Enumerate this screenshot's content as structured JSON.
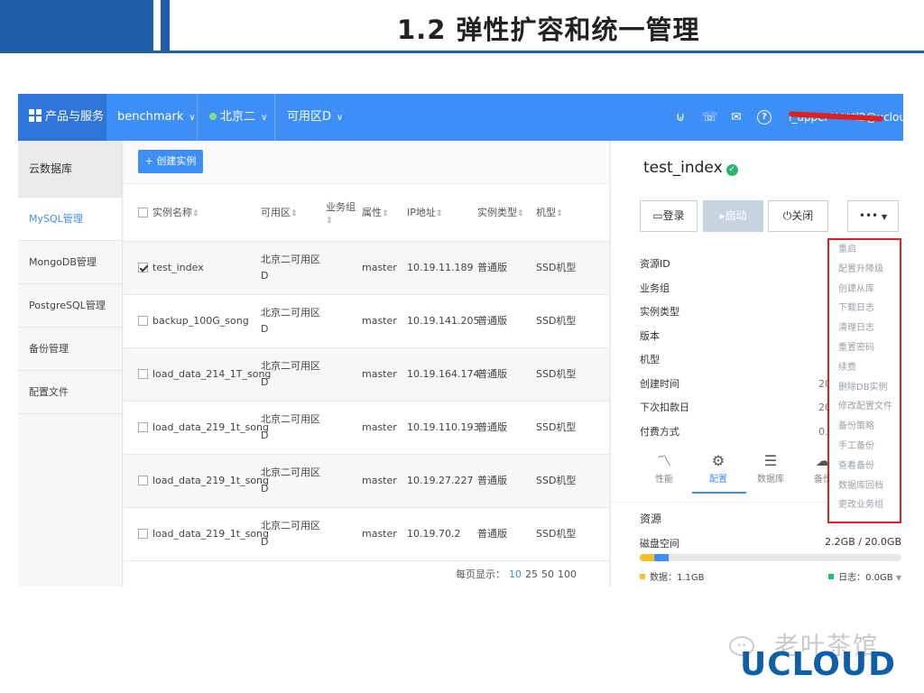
{
  "slide": {
    "title": "1.2 弹性扩容和统一管理"
  },
  "topbar": {
    "brand": "产品与服务",
    "project": "benchmark",
    "region": "北京二",
    "zone": "可用区D",
    "user": "l_upper*****l2@ucloud.cn"
  },
  "sidebar": {
    "header": "云数据库",
    "items": [
      {
        "label": "MySQL管理",
        "active": true
      },
      {
        "label": "MongoDB管理",
        "active": false
      },
      {
        "label": "PostgreSQL管理",
        "active": false
      },
      {
        "label": "备份管理",
        "active": false
      },
      {
        "label": "配置文件",
        "active": false
      }
    ]
  },
  "main": {
    "create_button": "+ 创建实例",
    "columns": [
      "实例名称",
      "可用区",
      "业务组",
      "属性",
      "IP地址",
      "实例类型",
      "机型"
    ],
    "rows": [
      {
        "checked": true,
        "name": "test_index",
        "zone": "北京二可用区D",
        "role": "master",
        "ip": "10.19.11.189",
        "type": "普通版",
        "machine": "SSD机型"
      },
      {
        "checked": false,
        "name": "backup_100G_song",
        "zone": "北京二可用区D",
        "role": "master",
        "ip": "10.19.141.205",
        "type": "普通版",
        "machine": "SSD机型"
      },
      {
        "checked": false,
        "name": "load_data_214_1T_song",
        "zone": "北京二可用区D",
        "role": "master",
        "ip": "10.19.164.174",
        "type": "普通版",
        "machine": "SSD机型"
      },
      {
        "checked": false,
        "name": "load_data_219_1t_song",
        "zone": "北京二可用区D",
        "role": "master",
        "ip": "10.19.110.193",
        "type": "普通版",
        "machine": "SSD机型"
      },
      {
        "checked": false,
        "name": "load_data_219_1t_song",
        "zone": "北京二可用区D",
        "role": "master",
        "ip": "10.19.27.227",
        "type": "普通版",
        "machine": "SSD机型"
      },
      {
        "checked": false,
        "name": "load_data_219_1t_song",
        "zone": "北京二可用区D",
        "role": "master",
        "ip": "10.19.70.2",
        "type": "普通版",
        "machine": "SSD机型"
      }
    ],
    "pager": {
      "label": "每页显示：",
      "sizes": [
        "10",
        "25",
        "50",
        "100"
      ],
      "active": "10"
    }
  },
  "detail": {
    "title": "test_index",
    "buttons": {
      "login": "登录",
      "start": "启动",
      "stop": "关闭",
      "more": "•••"
    },
    "props": [
      {
        "label": "资源ID",
        "value": ""
      },
      {
        "label": "业务组",
        "value": ""
      },
      {
        "label": "实例类型",
        "value": ""
      },
      {
        "label": "版本",
        "value": ""
      },
      {
        "label": "机型",
        "value": ""
      },
      {
        "label": "创建时间",
        "value": "20"
      },
      {
        "label": "下次扣款日",
        "value": "20"
      },
      {
        "label": "付费方式",
        "value": "0."
      }
    ],
    "tabs": [
      {
        "label": "性能",
        "icon": "line-chart-icon"
      },
      {
        "label": "配置",
        "icon": "gear-icon"
      },
      {
        "label": "数据库",
        "icon": "database-icon"
      },
      {
        "label": "备份",
        "icon": "cloud-backup-icon"
      }
    ],
    "active_tab": "配置",
    "resources": {
      "title": "资源",
      "disk_label": "磁盘空间",
      "disk_value": "2.2GB / 20.0GB",
      "data_fraction": 0.055,
      "log_fraction": 0.055,
      "data_legend": "数据：1.1GB",
      "log_legend": "日志：0.0GB"
    }
  },
  "menu": {
    "items": [
      "重启",
      "配置升降级",
      "创建从库",
      "下载日志",
      "清理日志",
      "重置密码",
      "续费",
      "删除DB实例",
      "修改配置文件",
      "备份策略",
      "手工备份",
      "查看备份",
      "数据库回档",
      "更改业务组"
    ]
  },
  "watermark": {
    "text": "老叶茶馆",
    "logo": "UCLOUD"
  },
  "colors": {
    "topbar": "#3e8ef7",
    "accent": "#3e8ef7",
    "highlight": "#e32020",
    "slide_blue": "#1f5fa8"
  }
}
